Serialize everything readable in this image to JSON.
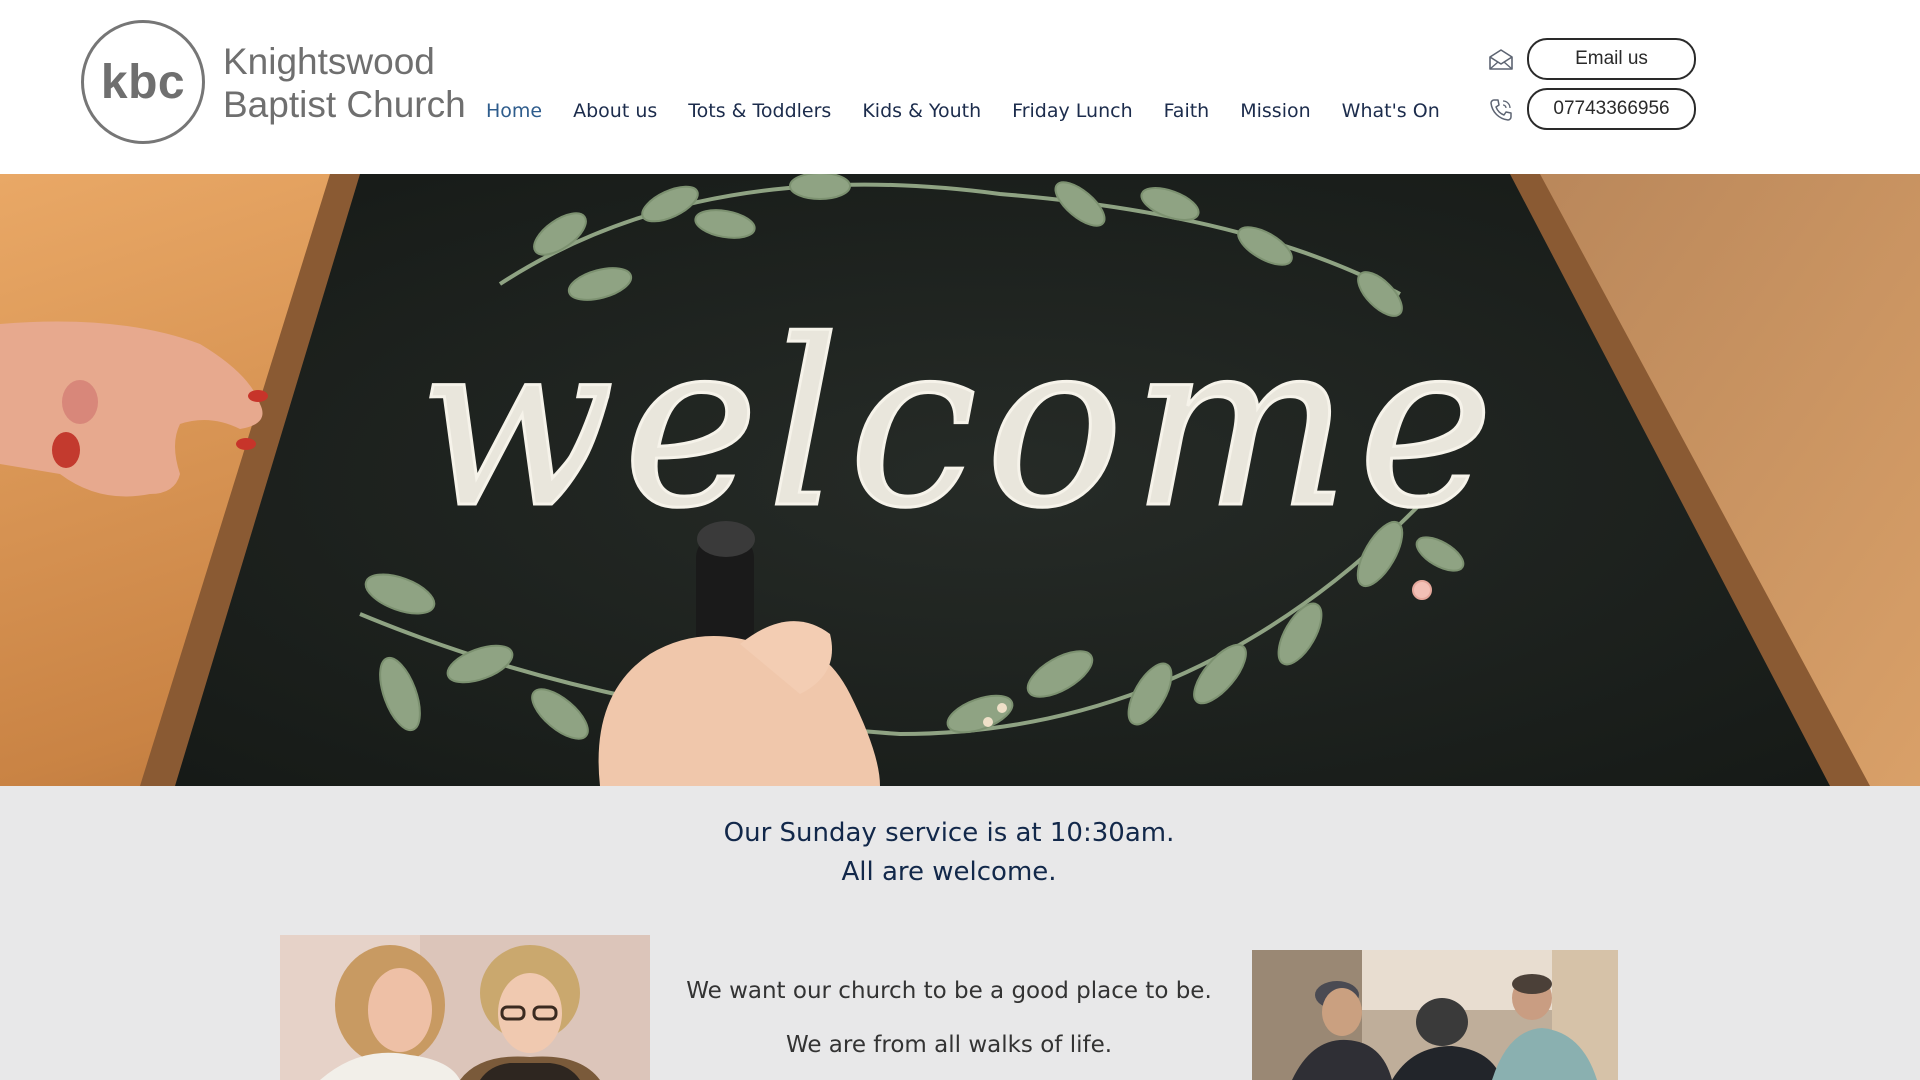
{
  "header": {
    "logo_text": "kbc",
    "site_name_line1": "Knightswood",
    "site_name_line2": "Baptist Church",
    "nav": [
      {
        "label": "Home",
        "active": true
      },
      {
        "label": "About us",
        "active": false
      },
      {
        "label": "Tots & Toddlers",
        "active": false
      },
      {
        "label": "Kids & Youth",
        "active": false
      },
      {
        "label": "Friday Lunch",
        "active": false
      },
      {
        "label": "Faith",
        "active": false
      },
      {
        "label": "Mission",
        "active": false
      },
      {
        "label": "What's On",
        "active": false
      }
    ],
    "email_button": "Email us",
    "phone_button": "07743366956",
    "icons": [
      "envelope-icon",
      "phone-icon"
    ]
  },
  "hero": {
    "image_text": "welcome"
  },
  "main": {
    "service_line1": "Our Sunday service is at 10:30am.",
    "service_line2": "All are welcome.",
    "blurb_line1": "We want our church to be a good place to be.",
    "blurb_line2": "We are from all walks of life."
  },
  "colors": {
    "nav_text": "#1c2c4c",
    "nav_active": "#2e5c8c",
    "service_text": "#12284a",
    "content_background": "#e8e8e9",
    "chalkboard": "#1f2420",
    "leaf_green": "#8fa383"
  }
}
